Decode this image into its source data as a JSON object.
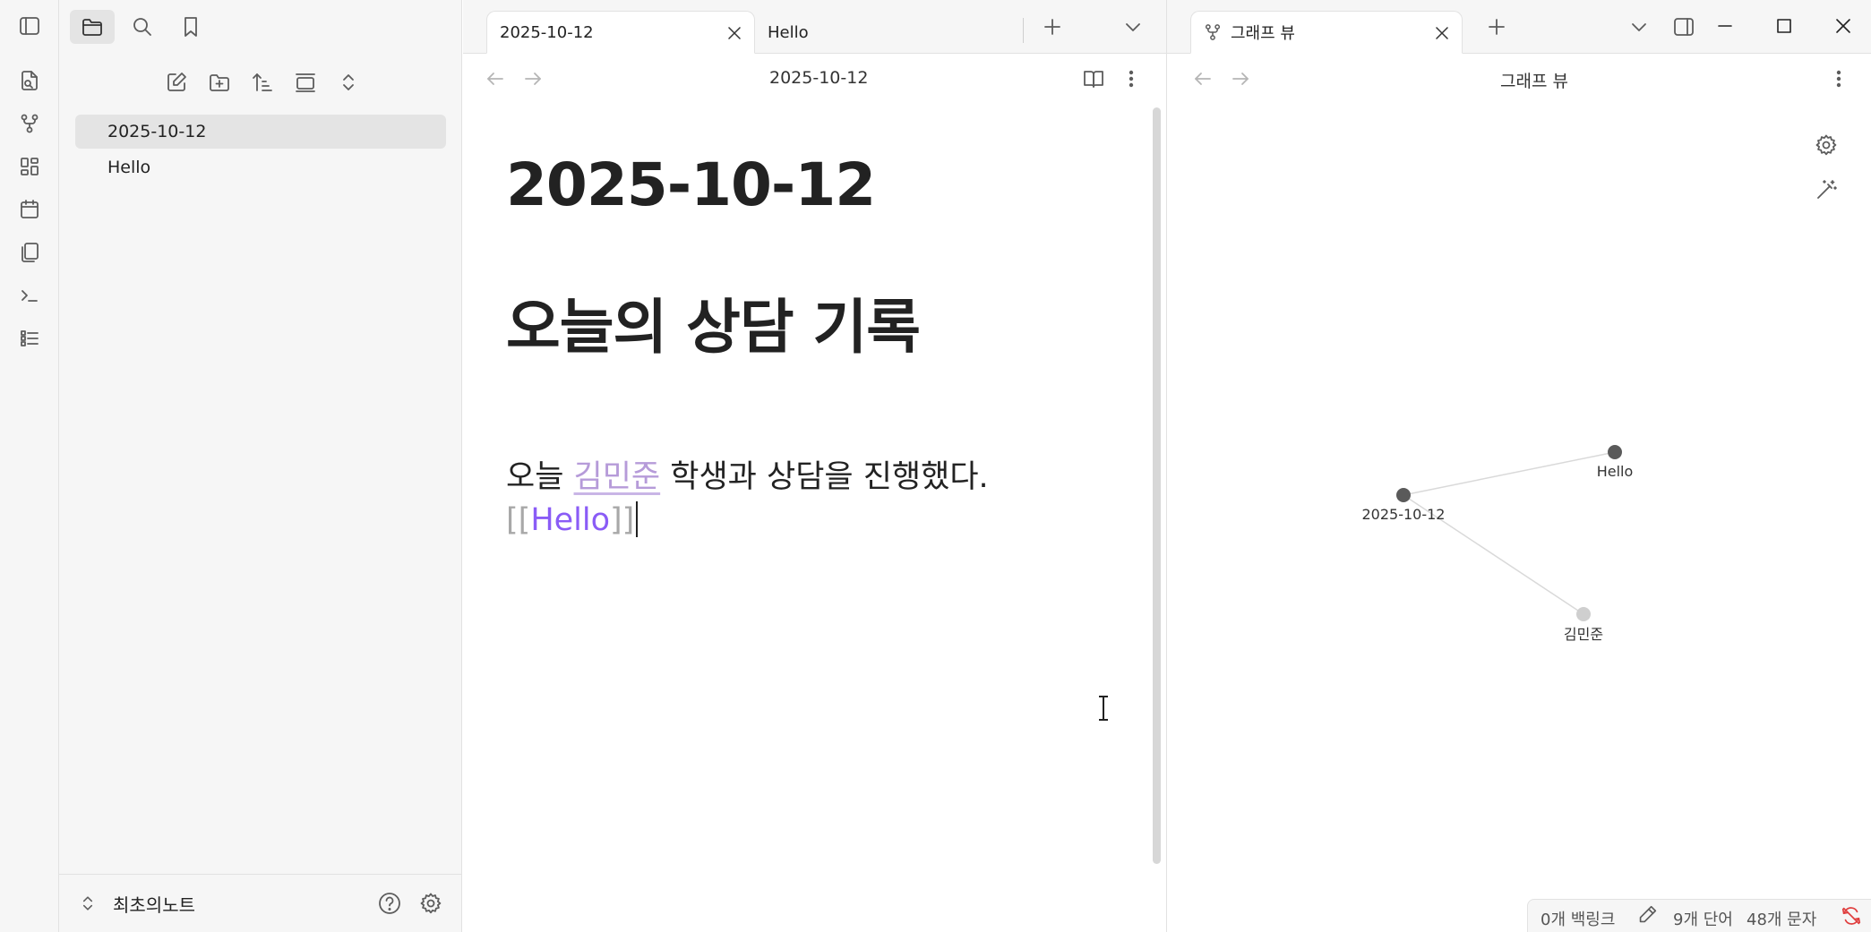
{
  "sidebar": {
    "files": [
      {
        "name": "2025-10-12",
        "active": true
      },
      {
        "name": "Hello",
        "active": false
      }
    ],
    "vault_name": "최초의노트"
  },
  "tabs_left": [
    {
      "label": "2025-10-12",
      "active": true
    },
    {
      "label": "Hello",
      "active": false
    }
  ],
  "tabs_right": [
    {
      "label": "그래프 뷰",
      "active": true
    }
  ],
  "editor": {
    "view_title": "2025-10-12",
    "heading_1": "2025-10-12",
    "heading_2": "오늘의 상담 기록",
    "para_before": "오늘 ",
    "para_link": "김민준",
    "para_after": " 학생과 상담을 진행했다.",
    "wiki_open": "[[",
    "wiki_name": "Hello",
    "wiki_close": "]]"
  },
  "graph": {
    "view_title": "그래프 뷰",
    "nodes": [
      {
        "label": "2025-10-12",
        "resolved": true
      },
      {
        "label": "Hello",
        "resolved": true
      },
      {
        "label": "김민준",
        "resolved": false
      }
    ],
    "edges": [
      [
        "2025-10-12",
        "Hello"
      ],
      [
        "2025-10-12",
        "김민준"
      ]
    ]
  },
  "status": {
    "backlinks": "0개 백링크",
    "words": "9개 단어",
    "chars": "48개 문자"
  },
  "colors": {
    "accent": "#8a5cf6",
    "unresolved_link": "#b69bd9",
    "node": "#5a5a5a",
    "node_unresolved": "#cfcfcf",
    "sync_error": "#e03e3e"
  }
}
